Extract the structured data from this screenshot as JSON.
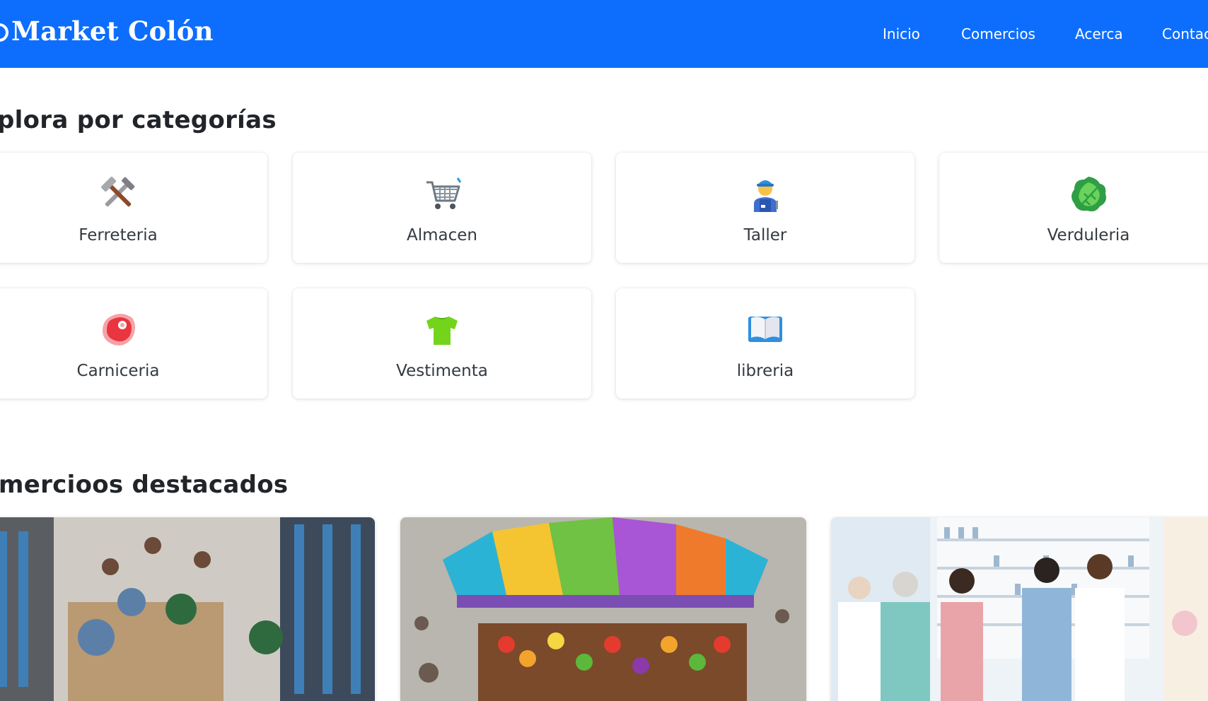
{
  "navbar": {
    "brand": "Market Colón",
    "links": [
      "Inicio",
      "Comercios",
      "Acerca",
      "Contac"
    ]
  },
  "categories": {
    "title": "plora por categorías",
    "items": [
      {
        "label": "Ferreteria",
        "icon": "hammer-wrench-icon"
      },
      {
        "label": "Almacen",
        "icon": "shopping-cart-icon"
      },
      {
        "label": "Taller",
        "icon": "mechanic-icon"
      },
      {
        "label": "Verduleria",
        "icon": "leafy-green-icon"
      },
      {
        "label": "Carniceria",
        "icon": "meat-icon"
      },
      {
        "label": "Vestimenta",
        "icon": "tshirt-icon"
      },
      {
        "label": "libreria",
        "icon": "open-book-icon"
      }
    ]
  },
  "featured": {
    "title": "mercioos destacados",
    "images": [
      "hardware-store-image",
      "market-stall-image",
      "pharmacy-image"
    ]
  },
  "colors": {
    "navbar": "#0d6efd",
    "text": "#212529"
  }
}
